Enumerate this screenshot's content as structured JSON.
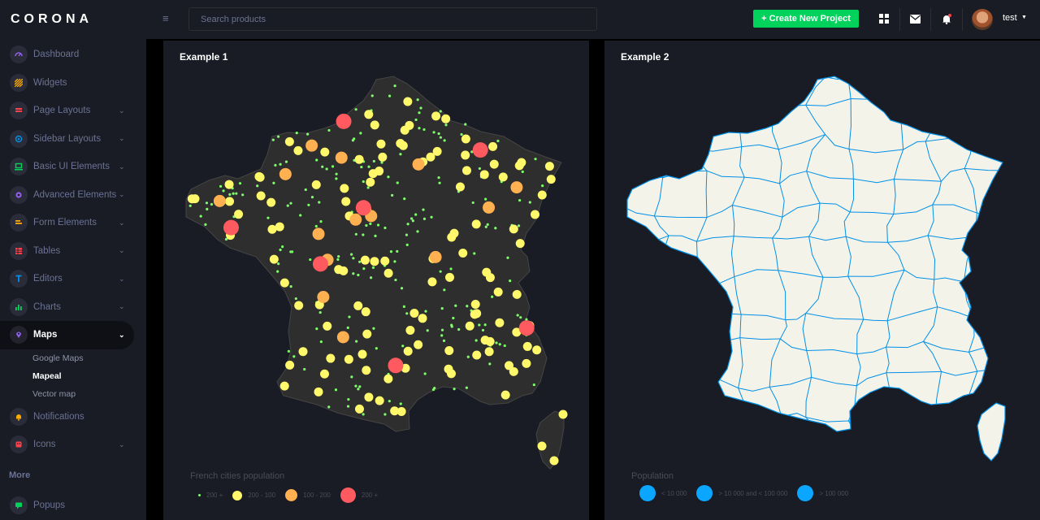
{
  "brand": "CORONA",
  "sidebar": {
    "items": [
      {
        "label": "Dashboard",
        "icon": "speedometer-icon",
        "color": "#8f5fe8"
      },
      {
        "label": "Widgets",
        "icon": "widgets-icon",
        "color": "#ffab00"
      },
      {
        "label": "Page Layouts",
        "icon": "layout-icon",
        "color": "#fc424a"
      },
      {
        "label": "Sidebar Layouts",
        "icon": "sidebar-layout-icon",
        "color": "#0090e7"
      },
      {
        "label": "Basic UI Elements",
        "icon": "laptop-icon",
        "color": "#00d25b"
      },
      {
        "label": "Advanced Elements",
        "icon": "settings-icon",
        "color": "#8f5fe8"
      },
      {
        "label": "Form Elements",
        "icon": "form-icon",
        "color": "#ffab00"
      },
      {
        "label": "Tables",
        "icon": "table-icon",
        "color": "#fc424a"
      },
      {
        "label": "Editors",
        "icon": "editor-icon",
        "color": "#0090e7"
      },
      {
        "label": "Charts",
        "icon": "chart-icon",
        "color": "#00d25b"
      },
      {
        "label": "Maps",
        "icon": "map-marker-icon",
        "color": "#8f5fe8"
      }
    ],
    "maps_sub": [
      "Google Maps",
      "Mapeal",
      "Vector map"
    ],
    "after": [
      {
        "label": "Notifications",
        "icon": "bell-icon",
        "color": "#ffab00"
      },
      {
        "label": "Icons",
        "icon": "icons-icon",
        "color": "#fc424a"
      }
    ],
    "category_more": "More",
    "popups": {
      "label": "Popups",
      "icon": "popup-icon",
      "color": "#00d25b"
    }
  },
  "header": {
    "search_placeholder": "Search products",
    "create_button": "+ Create New Project",
    "user_name": "test"
  },
  "colors": {
    "bg": "#000000",
    "panel": "#191c24",
    "map_fill": "#2e2e2e",
    "map2_fill": "#f4f3ea",
    "map2_border": "#0090e7",
    "small": "#7cff68",
    "yellow": "#fff86a",
    "orange": "#ffb050",
    "red": "#ff5a5f",
    "blue": "#0ba6ff"
  },
  "example1": {
    "title": "Example 1",
    "legend_title": "French cities population",
    "legend": [
      "200 +",
      "200 - 100",
      "100 - 200",
      "200 +"
    ]
  },
  "example2": {
    "title": "Example 2",
    "legend_title": "Population",
    "legend": [
      "< 10 000",
      "> 10 000 and < 100 000",
      "> 100 000"
    ]
  }
}
